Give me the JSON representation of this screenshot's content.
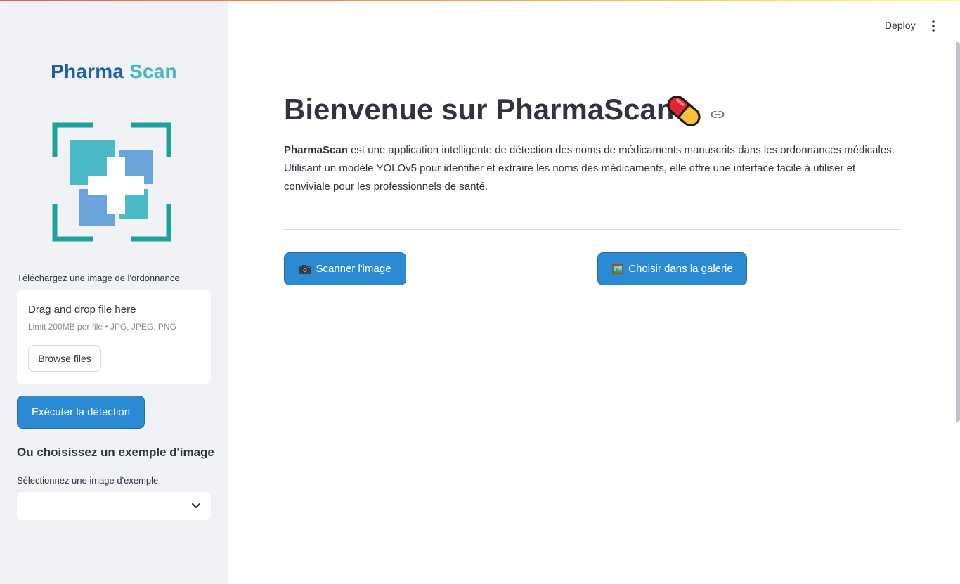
{
  "header": {
    "deploy_label": "Deploy"
  },
  "sidebar": {
    "brand_part1": "Pharma",
    "brand_part2": "Scan",
    "upload_label": "Téléchargez une image de l'ordonnance",
    "uploader": {
      "drop_text": "Drag and drop file here",
      "limit_text": "Limit 200MB per file • JPG, JPEG, PNG",
      "browse_label": "Browse files"
    },
    "run_label": "Exécuter la détection",
    "example_heading": "Ou choisissez un exemple d'image",
    "example_select_label": "Sélectionnez une image d'exemple",
    "example_select_value": ""
  },
  "main": {
    "title": "Bienvenue sur PharmaScan",
    "intro_bold": "PharmaScan",
    "intro_rest": "est une application intelligente de détection des noms de médicaments manuscrits dans les ordonnances médicales. Utilisant un modèle YOLOv5 pour identifier et extraire les noms des médicaments, elle offre une interface facile à utiliser et conviviale pour les professionnels de santé.",
    "scan_button": "Scanner l'image",
    "gallery_button": "Choisir dans la galerie"
  },
  "icons": {
    "title_icon": "pill-icon",
    "anchor_icon": "link-icon",
    "scan_icon": "camera-icon",
    "gallery_icon": "picture-icon",
    "menu_icon": "kebab-menu-icon",
    "select_icon": "chevron-down-icon",
    "logo": "medical-scan-logo"
  },
  "colors": {
    "primary_button": "#2a8bd4",
    "sidebar_bg": "#f0f2f6",
    "brand_dark": "#1f5fa8",
    "brand_light": "#41b6c4"
  }
}
